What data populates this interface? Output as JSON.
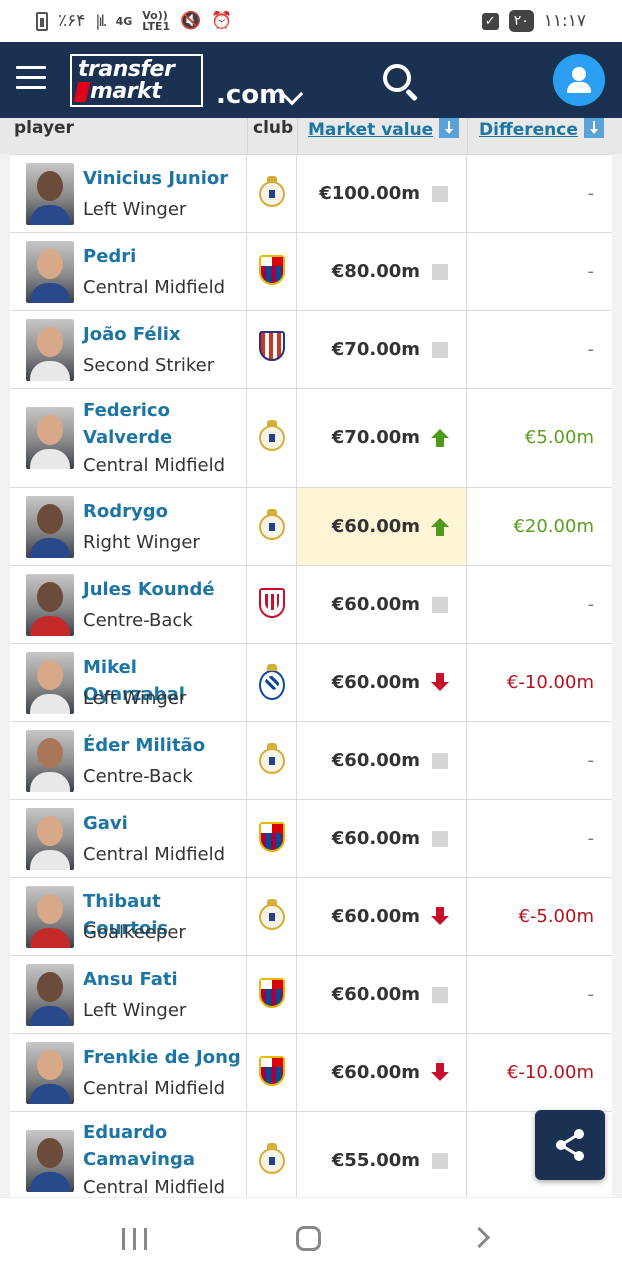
{
  "status_bar": {
    "battery": "٪۶۴",
    "signal_label": "4G",
    "volte_top": "Vo))",
    "volte_bottom": "LTE1",
    "badge": "۲۰",
    "time": "۱۱:۱۷"
  },
  "header": {
    "logo_top": "transfer",
    "logo_bottom": "markt",
    "domain": ".com",
    "icons": {
      "menu": "hamburger-icon",
      "search": "search-icon",
      "user": "user-icon"
    },
    "colors": {
      "background": "#1a3151",
      "user_button": "#2c9ff2"
    }
  },
  "table": {
    "columns": {
      "player": "player",
      "club": "club",
      "market_value": "Market value",
      "difference": "Difference"
    },
    "rows": [
      {
        "name": "Vinicius Junior",
        "position": "Left Winger",
        "club": "Real Madrid",
        "market_value": "€100.00m",
        "trend": "none",
        "difference": "-"
      },
      {
        "name": "Pedri",
        "position": "Central Midfield",
        "club": "FC Barcelona",
        "market_value": "€80.00m",
        "trend": "none",
        "difference": "-"
      },
      {
        "name": "João Félix",
        "position": "Second Striker",
        "club": "Atlético Madrid",
        "market_value": "€70.00m",
        "trend": "none",
        "difference": "-"
      },
      {
        "name": "Federico Valverde",
        "position": "Central Midfield",
        "club": "Real Madrid",
        "market_value": "€70.00m",
        "trend": "up",
        "difference": "€5.00m"
      },
      {
        "name": "Rodrygo",
        "position": "Right Winger",
        "club": "Real Madrid",
        "market_value": "€60.00m",
        "trend": "up",
        "difference": "€20.00m"
      },
      {
        "name": "Jules Koundé",
        "position": "Centre-Back",
        "club": "Sevilla FC",
        "market_value": "€60.00m",
        "trend": "none",
        "difference": "-"
      },
      {
        "name": "Mikel Oyarzabal",
        "position": "Left Winger",
        "club": "Real Sociedad",
        "market_value": "€60.00m",
        "trend": "down",
        "difference": "€-10.00m"
      },
      {
        "name": "Éder Militão",
        "position": "Centre-Back",
        "club": "Real Madrid",
        "market_value": "€60.00m",
        "trend": "none",
        "difference": "-"
      },
      {
        "name": "Gavi",
        "position": "Central Midfield",
        "club": "FC Barcelona",
        "market_value": "€60.00m",
        "trend": "none",
        "difference": "-"
      },
      {
        "name": "Thibaut Courtois",
        "position": "Goalkeeper",
        "club": "Real Madrid",
        "market_value": "€60.00m",
        "trend": "down",
        "difference": "€-5.00m"
      },
      {
        "name": "Ansu Fati",
        "position": "Left Winger",
        "club": "FC Barcelona",
        "market_value": "€60.00m",
        "trend": "none",
        "difference": "-"
      },
      {
        "name": "Frenkie de Jong",
        "position": "Central Midfield",
        "club": "FC Barcelona",
        "market_value": "€60.00m",
        "trend": "down",
        "difference": "€-10.00m"
      },
      {
        "name": "Eduardo Camavinga",
        "position": "Central Midfield",
        "club": "Real Madrid",
        "market_value": "€55.00m",
        "trend": "none",
        "difference": ""
      }
    ],
    "colors": {
      "positive": "#5b9e1d",
      "negative": "#b3131e",
      "link": "#1d75a3",
      "highlight": "#fdf5d6"
    }
  },
  "share_button": {
    "icon": "share-icon"
  },
  "nav_bar": {
    "recents": "recents-icon",
    "home": "home-icon",
    "back": "back-icon"
  }
}
